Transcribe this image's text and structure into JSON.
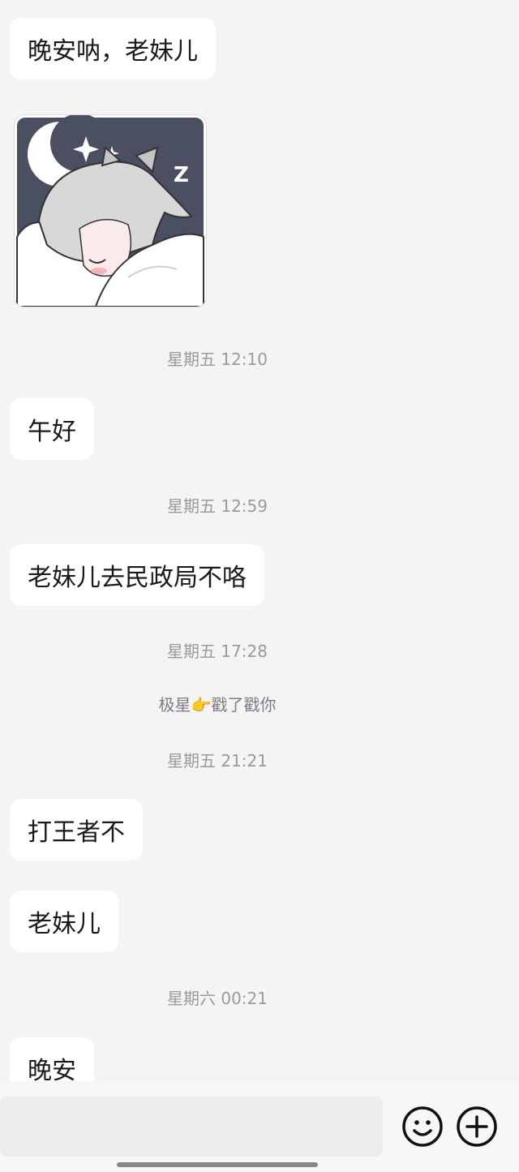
{
  "messages": {
    "m1": "晚安呐，老妹儿",
    "m2": "午好",
    "m3": "老妹儿去民政局不咯",
    "m4": "打王者不",
    "m5": "老妹儿",
    "m6": "晚安"
  },
  "timestamps": {
    "t1": "星期五 12:10",
    "t2": "星期五 12:59",
    "t3": "星期五 17:28",
    "t4": "星期五 21:21",
    "t5": "星期六 00:21"
  },
  "system": {
    "poke_name": "极星",
    "poke_emoji": "👉",
    "poke_text": "戳了戳你"
  },
  "sticker": {
    "icon": "sleeping-wolf-girl-sticker",
    "zzz": "Z"
  },
  "input_bar": {
    "placeholder": "",
    "emoji_icon": "smiley-icon",
    "plus_icon": "plus-circle-icon"
  }
}
